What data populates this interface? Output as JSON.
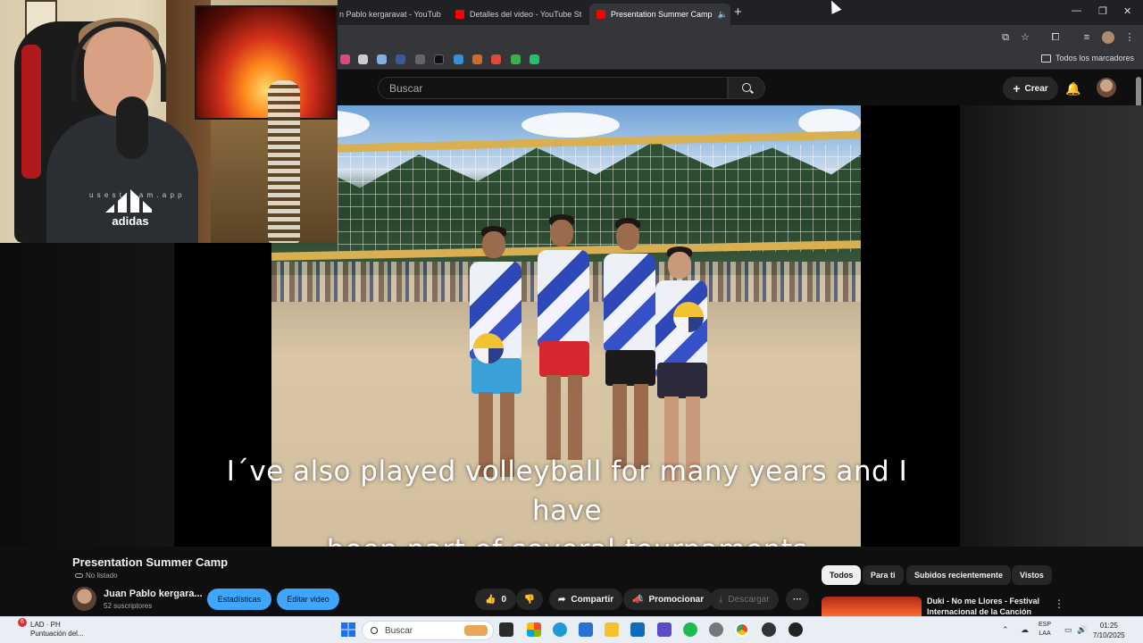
{
  "browser": {
    "tabs": [
      {
        "label": "n Pablo kergaravat - YouTub",
        "active": false
      },
      {
        "label": "Detalles del video - YouTube St",
        "active": false
      },
      {
        "label": "Presentation Summer Camp",
        "active": true
      }
    ],
    "new_tab": "+",
    "bookmarks_all_label": "Todos los marcadores"
  },
  "youtube": {
    "search_placeholder": "Buscar",
    "create_label": "Crear"
  },
  "video": {
    "caption_line1": "I´ve also played volleyball for many years and I have",
    "caption_line2": "been part of several tournaments",
    "title": "Presentation Summer Camp",
    "visibility": "No listado",
    "channel_name": "Juan Pablo kergara...",
    "subscribers": "52 suscriptores",
    "stats_button": "Estadísticas",
    "edit_button": "Editar video",
    "likes": "0",
    "share_label": "Compartir",
    "promote_label": "Promocionar",
    "download_label": "Descargar",
    "more_label": "···"
  },
  "webcam": {
    "watermark": "u s e  s t r e a m . a p p",
    "shirt_text": "adidas"
  },
  "recommendations": {
    "chips": [
      "Todos",
      "Para ti",
      "Subidos recientemente",
      "Vistos"
    ],
    "selected_chip": "Todos",
    "first_title": "Duki - No me Llores - Festival Internacional de la Canción de..."
  },
  "taskbar": {
    "weather_line1": "LAD · PH",
    "weather_line2": "Puntuación del...",
    "badge": "6",
    "search_label": "Buscar",
    "lang_line1": "ESP",
    "lang_line2": "LAA",
    "time": "01:25",
    "date": "7/10/2025"
  },
  "colors": {
    "accent_blue": "#3ea6ff",
    "youtube_red": "#ff0000",
    "background": "#0f0f0f"
  }
}
